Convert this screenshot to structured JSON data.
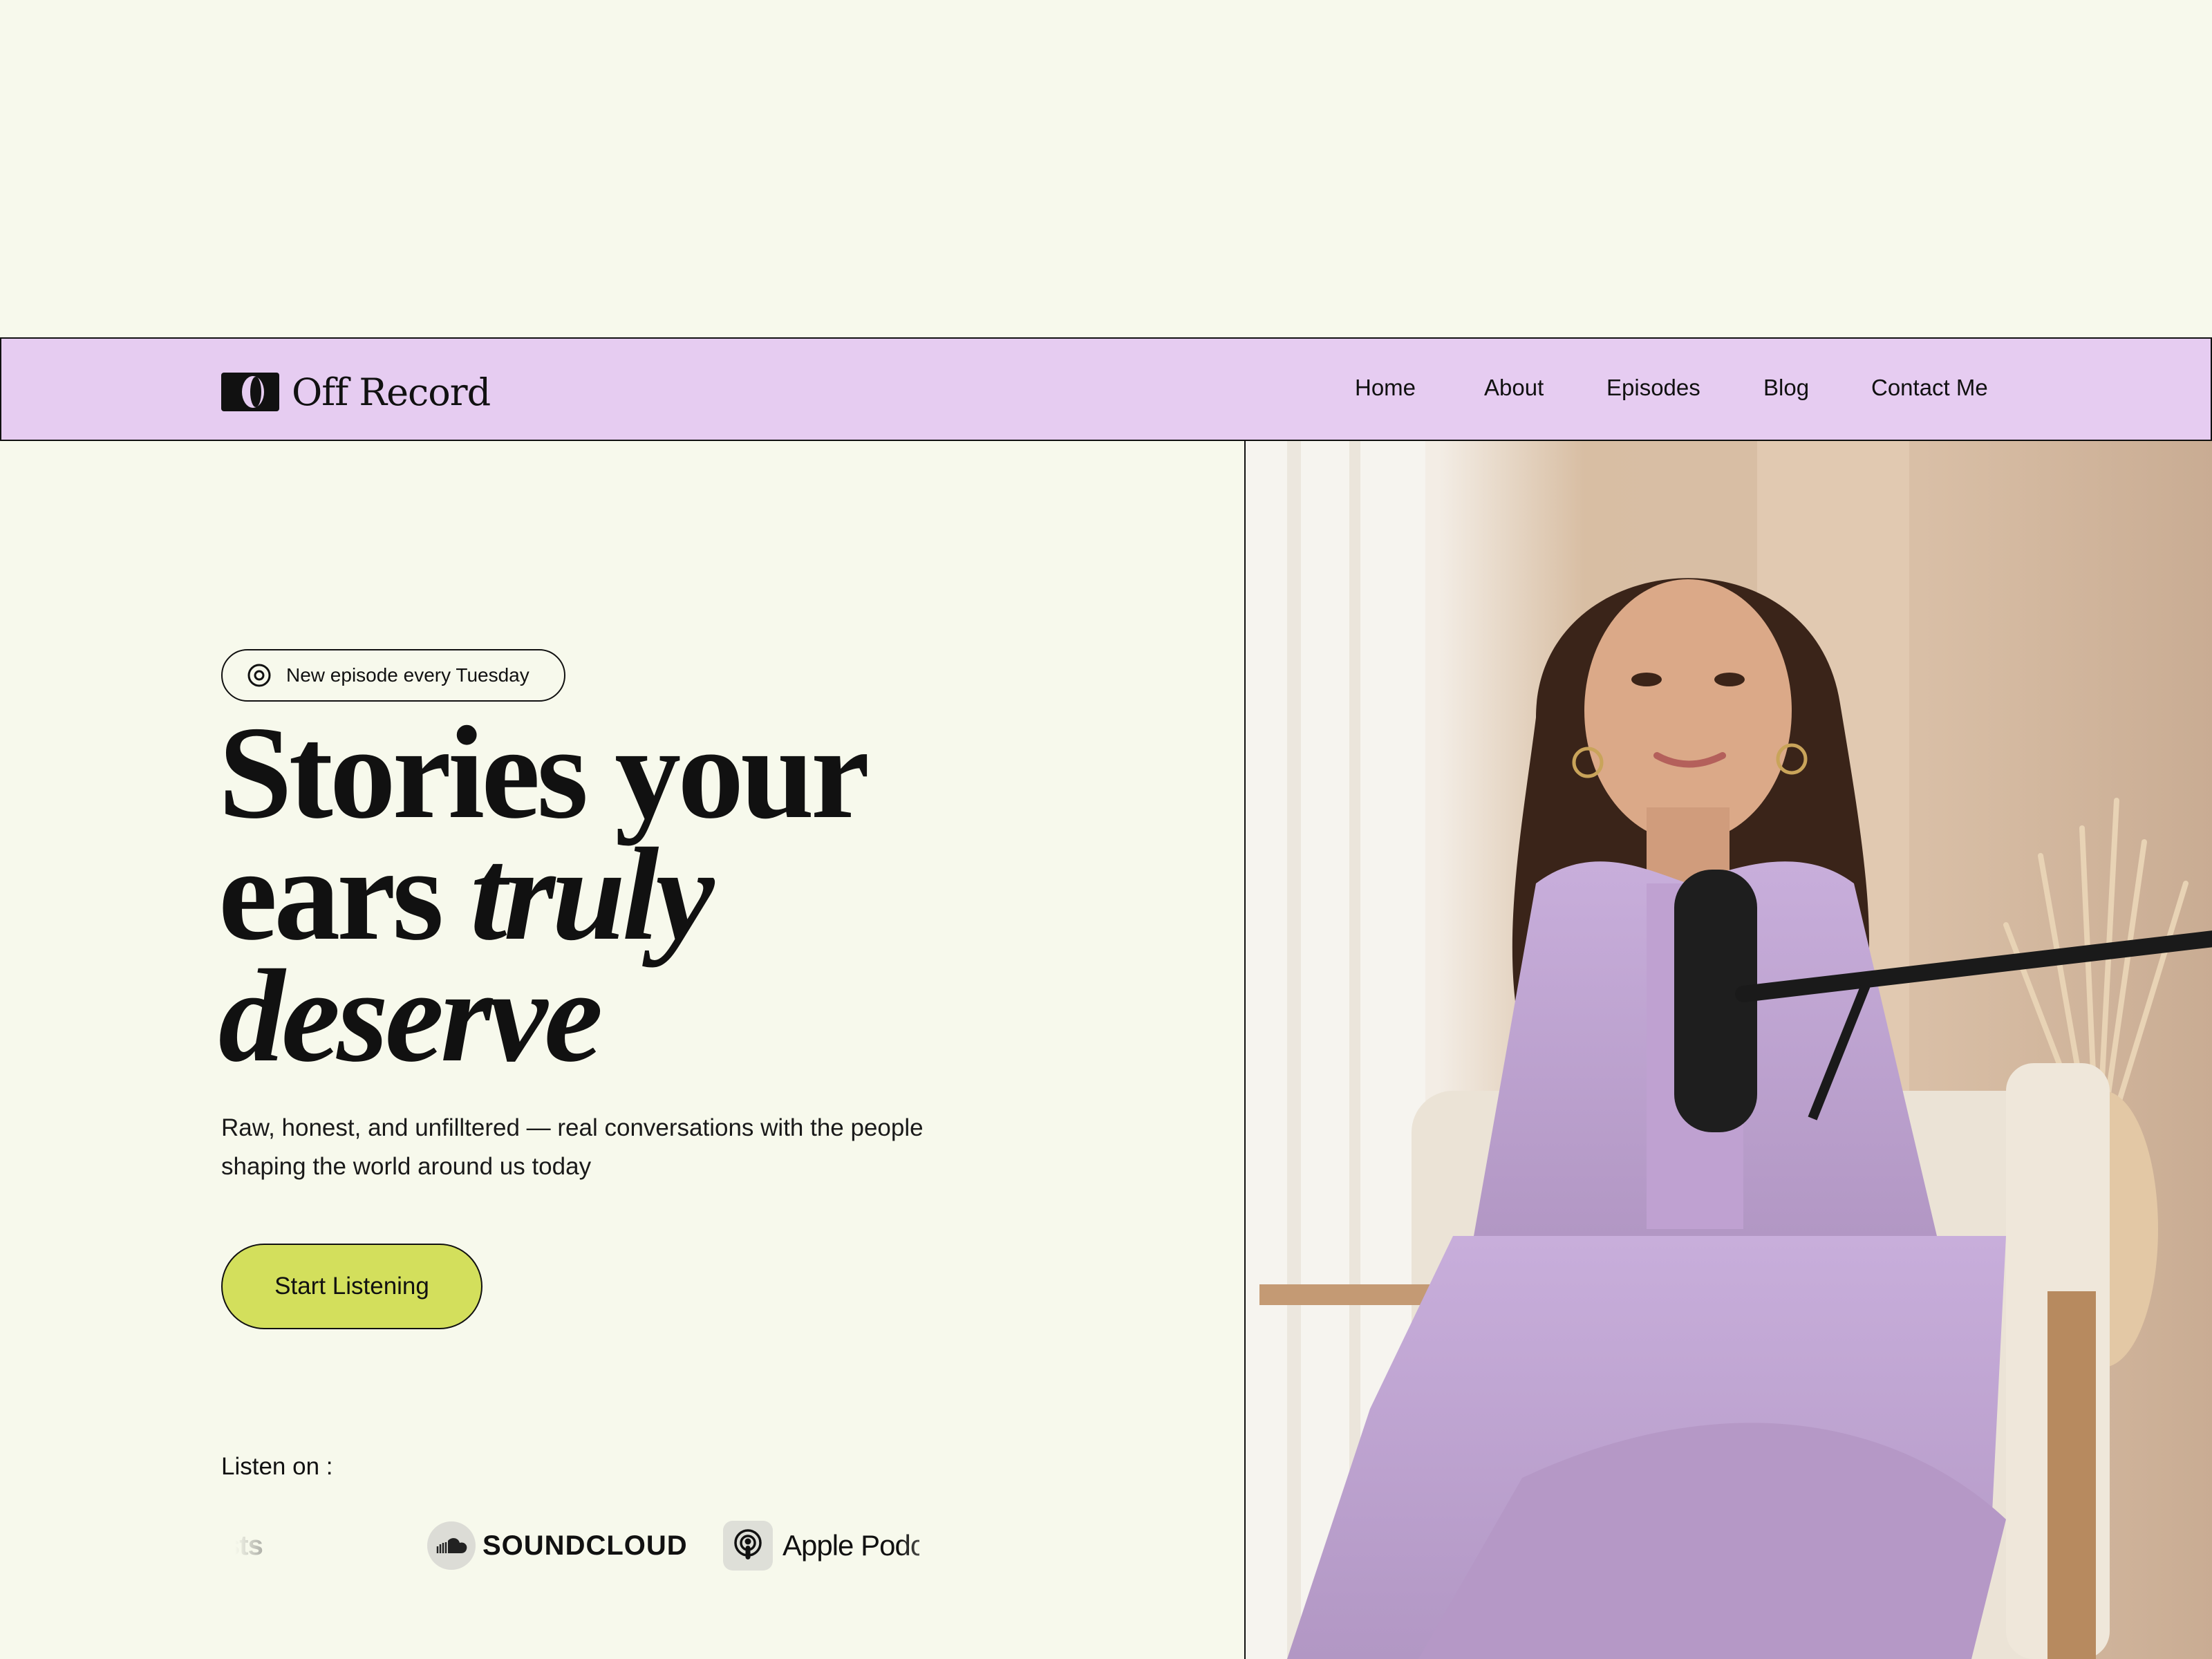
{
  "brand": {
    "name": "Off Record",
    "logo_icon": "logo-mark-icon"
  },
  "nav": {
    "items": [
      {
        "label": "Home"
      },
      {
        "label": "About"
      },
      {
        "label": "Episodes"
      },
      {
        "label": "Blog"
      },
      {
        "label": "Contact Me"
      }
    ]
  },
  "hero": {
    "badge": {
      "icon": "target-icon",
      "text": "New episode every Tuesday"
    },
    "headline": {
      "line1": "Stories your",
      "line2_plain": "ears",
      "line2_italic": "truly",
      "line3_italic": "deserve"
    },
    "subtitle": "Raw, honest, and unfilltered — real conversations with the people shaping the world around us today",
    "cta_label": "Start Listening",
    "listen_label": "Listen on :",
    "platforms": [
      {
        "name": "Google Podcasts",
        "visible_text": "dcasts"
      },
      {
        "name": "SoundCloud",
        "icon": "soundcloud-icon",
        "visible_text": "SOUNDCLOUD"
      },
      {
        "name": "Apple Podcasts",
        "icon": "apple-podcasts-icon",
        "visible_text": "Apple Podcasts"
      }
    ]
  },
  "photo": {
    "description_icon": "host-photo"
  },
  "colors": {
    "background": "#f7f9ec",
    "nav_background": "#e6ccf1",
    "cta_background": "#d3df5c",
    "text": "#111111"
  }
}
